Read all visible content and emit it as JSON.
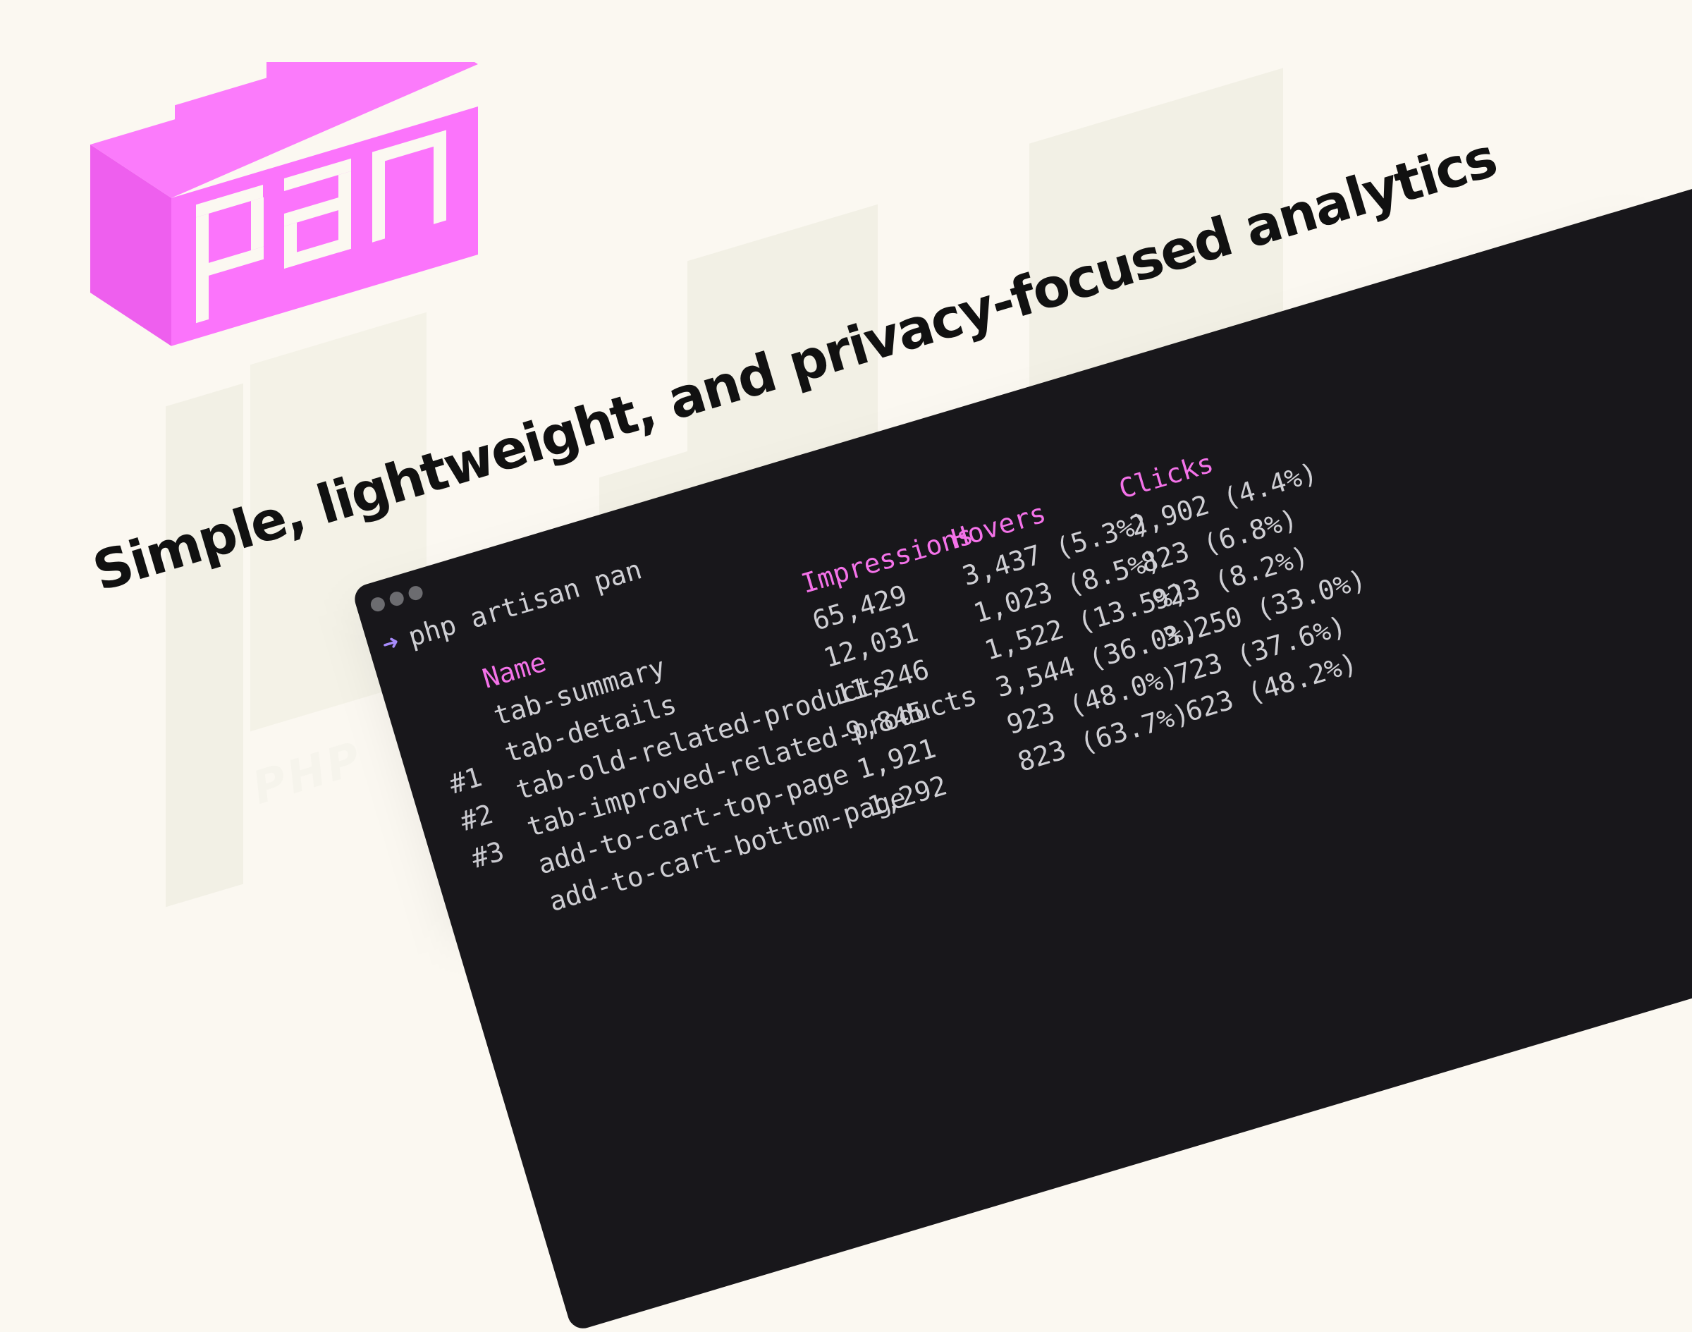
{
  "brand": {
    "logo_text": "pan",
    "colors": {
      "accent": "#f472e9",
      "logo_face": "#fb74fb",
      "terminal_bg": "#18171b",
      "page_bg": "#fbf8f1"
    }
  },
  "tagline": "Simple, lightweight, and privacy-focused analytics",
  "background_text": "PHP",
  "terminal": {
    "prompt_icon": "arrow-right-icon",
    "command": "php artisan pan",
    "columns": {
      "name": "Name",
      "impressions": "Impressions",
      "hovers": "Hovers",
      "clicks": "Clicks"
    },
    "rows": [
      {
        "rank": "",
        "name": "tab-summary",
        "impressions": "65,429",
        "hovers": "3,437 (5.3%)",
        "clicks": "2,902 (4.4%)"
      },
      {
        "rank": "#1",
        "name": "tab-details",
        "impressions": "12,031",
        "hovers": "1,023 (8.5%)",
        "clicks": "823 (6.8%)"
      },
      {
        "rank": "#2",
        "name": "tab-old-related-products",
        "impressions": "11,246",
        "hovers": "1,522 (13.5%)",
        "clicks": "923 (8.2%)"
      },
      {
        "rank": "#3",
        "name": "tab-improved-related-products",
        "impressions": "9,845",
        "hovers": "3,544 (36.0%)",
        "clicks": "3,250 (33.0%)"
      },
      {
        "rank": "",
        "name": "add-to-cart-top-page",
        "impressions": "1,921",
        "hovers": "923 (48.0%)",
        "clicks": "723 (37.6%)"
      },
      {
        "rank": "",
        "name": "add-to-cart-bottom-page",
        "impressions": "1,292",
        "hovers": "823 (63.7%)",
        "clicks": "623 (48.2%)"
      }
    ]
  }
}
